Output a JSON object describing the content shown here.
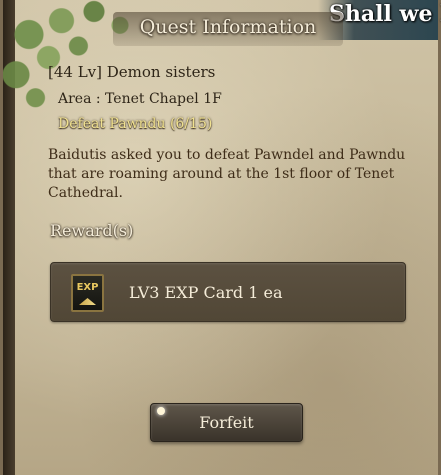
{
  "window": {
    "title": "Quest Information",
    "caption_overlay": "Shall we l"
  },
  "quest": {
    "name": "[44 Lv] Demon sisters",
    "area": "Area : Tenet Chapel 1F",
    "objective": "Defeat Pawndu (6/15)",
    "description": "Baidutis asked you to defeat Pawndel and Pawndu that are roaming around at the 1st floor of Tenet Cathedral."
  },
  "rewards": {
    "label": "Reward(s)",
    "items": [
      {
        "icon": "exp-card-icon",
        "icon_text": "EXP",
        "text": "LV3 EXP Card 1 ea"
      }
    ]
  },
  "actions": {
    "forfeit_label": "Forfeit"
  },
  "colors": {
    "parchment": "#c6b99a",
    "objective_text": "#f0e190",
    "reward_box": "#544a3a"
  }
}
